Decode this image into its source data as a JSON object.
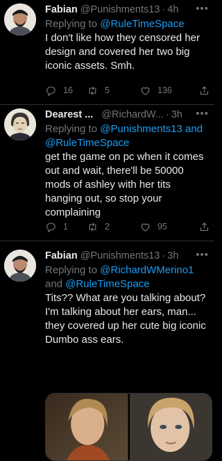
{
  "tweets": [
    {
      "name": "Fabian",
      "handle": "@Punishments13",
      "time": "4h",
      "reply_prefix": "Replying to ",
      "reply_to": "@RuleTimeSpace",
      "reply_joiner": "",
      "reply_to_2": "",
      "text": "I don't like how they censored her design and covered her two big iconic assets. Smh.",
      "replies": "16",
      "retweets": "5",
      "likes": "136"
    },
    {
      "name": "Dearest ...",
      "handle": "@RichardW...",
      "time": "3h",
      "reply_prefix": "Replying to ",
      "reply_to": "@Punishments13 and",
      "reply_joiner": "",
      "reply_to_2": "@RuleTimeSpace",
      "text": "get the game on pc when it comes out and wait, there'll be 50000 mods of ashley with her tits hanging out, so stop your complaining",
      "replies": "1",
      "retweets": "2",
      "likes": "95"
    },
    {
      "name": "Fabian",
      "handle": "@Punishments13",
      "time": "3h",
      "reply_prefix": "Replying to ",
      "reply_to": "@RichardWMerino1",
      "reply_joiner": "and ",
      "reply_to_2": "@RuleTimeSpace",
      "text": "Tits?? What are you talking about? I'm talking about her ears, man... they covered up her cute big iconic Dumbo ass ears."
    }
  ],
  "more_glyph": "•••",
  "dot": "·",
  "colors": {
    "link": "#1d9bf0",
    "muted": "#71767b",
    "text": "#e7e9ea",
    "bg": "#000000"
  },
  "icons": [
    "reply-icon",
    "retweet-icon",
    "like-icon",
    "share-icon",
    "more-icon"
  ]
}
